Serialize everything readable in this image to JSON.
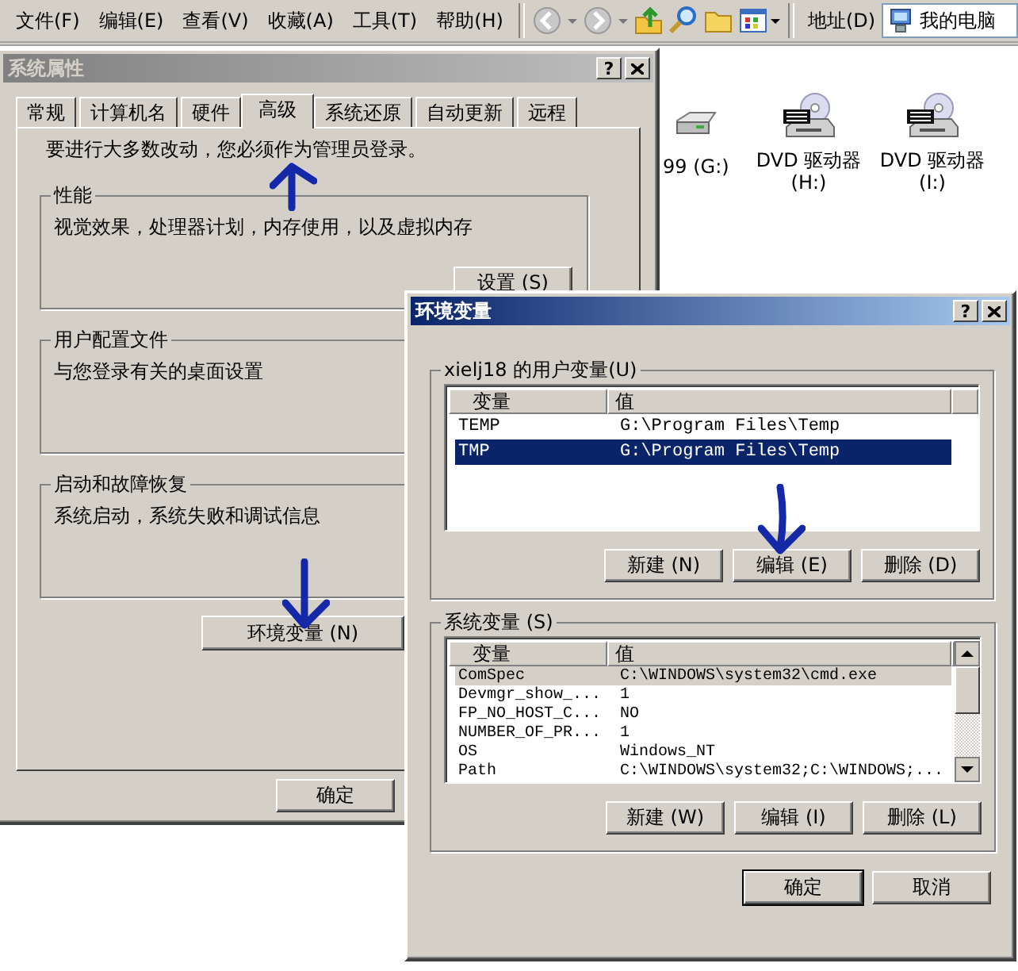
{
  "explorer": {
    "menu": [
      "文件(F)",
      "编辑(E)",
      "查看(V)",
      "收藏(A)",
      "工具(T)",
      "帮助(H)"
    ],
    "address_label": "地址(D)",
    "address": "我的电脑",
    "drives": [
      {
        "kind": "hdd",
        "label": "99 (G:)"
      },
      {
        "kind": "dvd",
        "label": "DVD 驱动器 (H:)"
      },
      {
        "kind": "dvd",
        "label": "DVD 驱动器 (I:)"
      }
    ]
  },
  "system_properties": {
    "title": "系统属性",
    "help": "?",
    "tabs": [
      {
        "label": "常规",
        "selected": false
      },
      {
        "label": "计算机名",
        "selected": false
      },
      {
        "label": "硬件",
        "selected": false
      },
      {
        "label": "高级",
        "selected": true
      },
      {
        "label": "系统还原",
        "selected": false
      },
      {
        "label": "自动更新",
        "selected": false
      },
      {
        "label": "远程",
        "selected": false
      }
    ],
    "note": "要进行大多数改动，您必须作为管理员登录。",
    "groups": [
      {
        "title": "性能",
        "description": "视觉效果，处理器计划，内存使用，以及虚拟内存",
        "button": "设置 (S)"
      },
      {
        "title": "用户配置文件",
        "description": "与您登录有关的桌面设置"
      },
      {
        "title": "启动和故障恢复",
        "description": "系统启动，系统失败和调试信息"
      }
    ],
    "env_button": "环境变量 (N)",
    "buttons": [
      "确定"
    ]
  },
  "environment_variables": {
    "title": "环境变量",
    "help": "?",
    "lists": [
      {
        "title": "xielj18 的用户变量(U)",
        "focused": true,
        "columns": [
          "变量",
          "值"
        ],
        "rows": [
          {
            "name": "TEMP",
            "value": "G:\\Program Files\\Temp",
            "selected": false
          },
          {
            "name": "TMP",
            "value": "G:\\Program Files\\Temp",
            "selected": true
          }
        ],
        "buttons": [
          "新建 (N)",
          "编辑 (E)",
          "删除 (D)"
        ]
      },
      {
        "title": "系统变量 (S)",
        "focused": false,
        "columns": [
          "变量",
          "值"
        ],
        "rows": [
          {
            "name": "ComSpec",
            "value": "C:\\WINDOWS\\system32\\cmd.exe",
            "selected": true
          },
          {
            "name": "Devmgr_show_...",
            "value": "1",
            "selected": false
          },
          {
            "name": "FP_NO_HOST_C...",
            "value": "NO",
            "selected": false
          },
          {
            "name": "NUMBER_OF_PR...",
            "value": "1",
            "selected": false
          },
          {
            "name": "OS",
            "value": "Windows_NT",
            "selected": false
          },
          {
            "name": "Path",
            "value": "C:\\WINDOWS\\system32;C:\\WINDOWS;...",
            "selected": false
          }
        ],
        "buttons": [
          "新建 (W)",
          "编辑 (I)",
          "删除 (L)"
        ]
      }
    ],
    "buttons": [
      "确定",
      "取消"
    ]
  }
}
